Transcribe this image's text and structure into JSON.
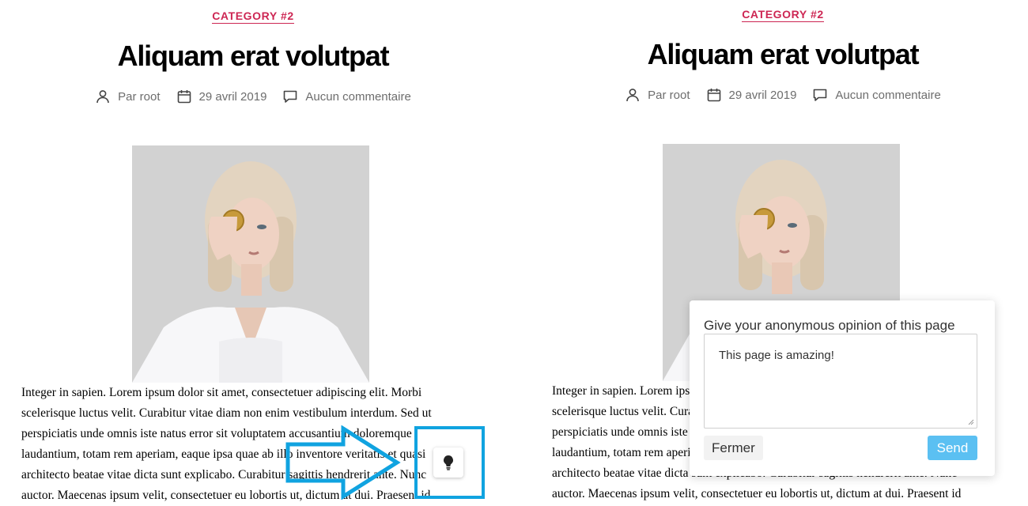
{
  "post": {
    "category": "CATEGORY #2",
    "title": "Aliquam erat volutpat",
    "author": "Par root",
    "date": "29 avril 2019",
    "comments": "Aucun commentaire",
    "body_lines": [
      "Integer in sapien. Lorem ipsum dolor sit amet, consectetuer adipiscing elit. Morbi",
      "scelerisque luctus velit. Curabitur vitae diam non enim vestibulum interdum. Sed ut",
      "perspiciatis unde omnis iste natus error sit voluptatem accusantium doloremque",
      "laudantium, totam rem aperiam, eaque ipsa quae ab illo inventore veritatis et quasi",
      "architecto beatae vitae dicta sunt explicabo. Curabitur sagittis hendrerit ante. Nunc",
      "auctor. Maecenas ipsum velit, consectetuer eu lobortis ut, dictum at dui. Praesent id"
    ]
  },
  "feedback": {
    "prompt": "Give your anonymous opinion of this page",
    "text": "This page is amazing!",
    "close_label": "Fermer",
    "send_label": "Send"
  },
  "colors": {
    "category": "#cd2653",
    "highlight": "#10a3e0",
    "send_button": "#5bc0f2"
  },
  "icons": {
    "author": "person-icon",
    "date": "calendar-icon",
    "comments": "comment-bubble-icon",
    "launcher": "lightbulb-icon"
  }
}
